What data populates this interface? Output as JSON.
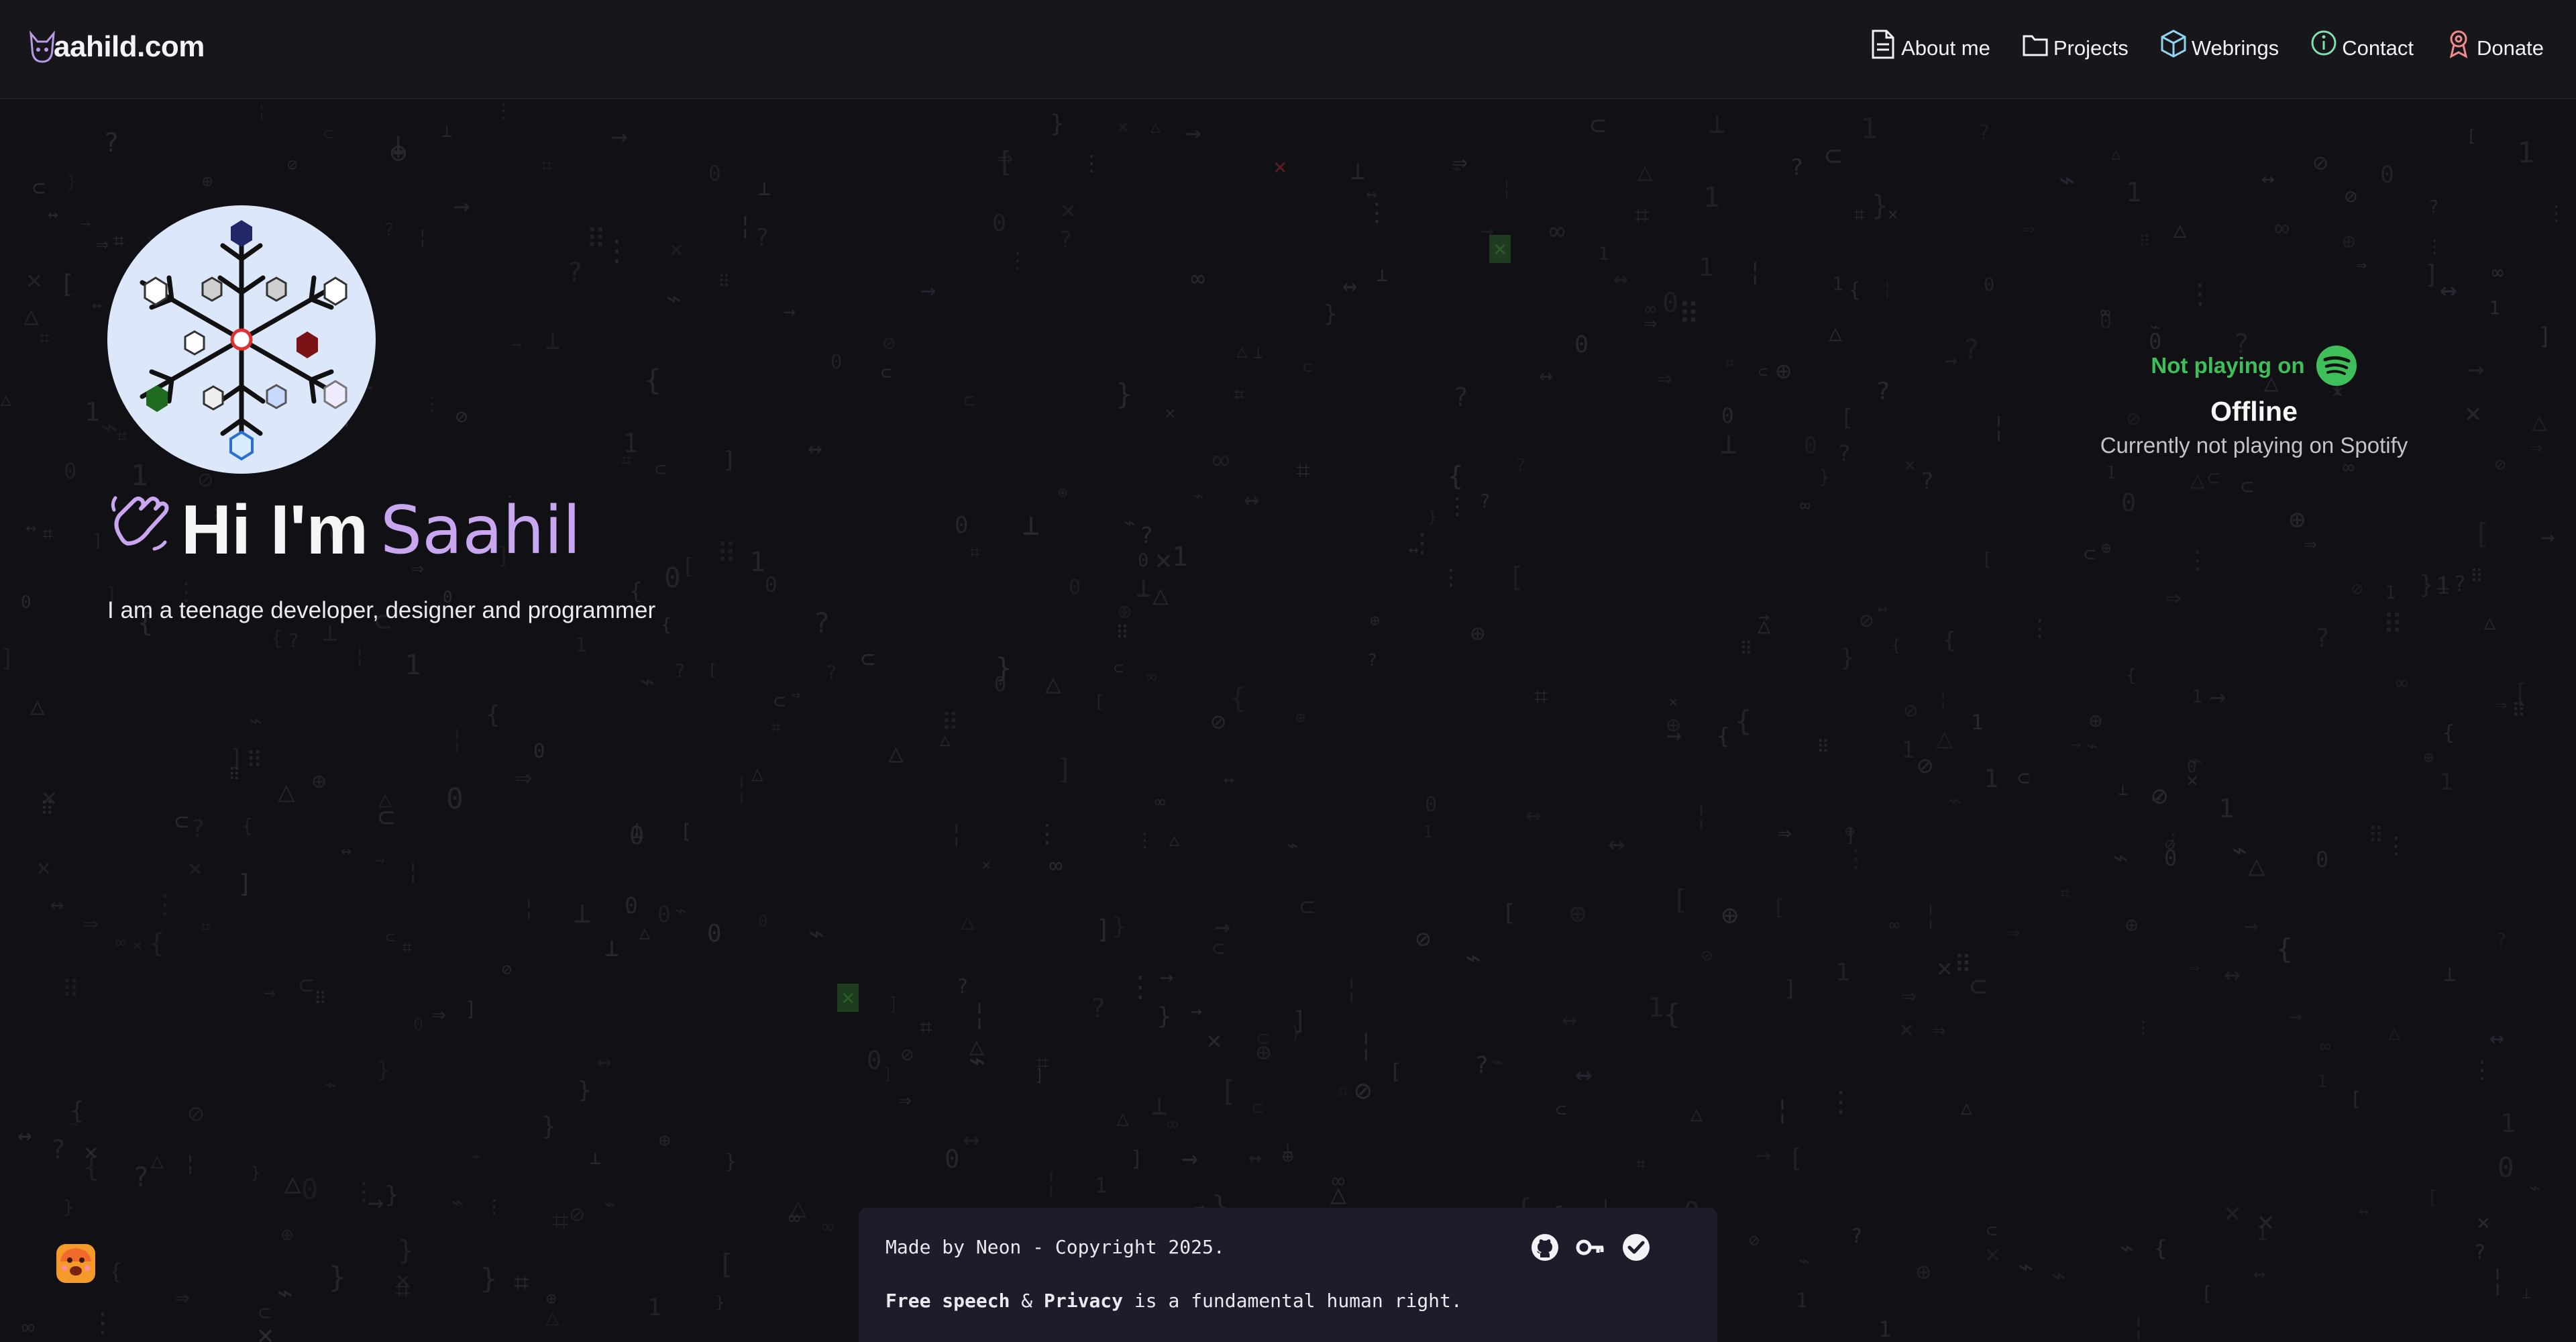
{
  "header": {
    "logo_text": "aahild.com",
    "nav": [
      {
        "label": "About me",
        "icon": "document-icon"
      },
      {
        "label": "Projects",
        "icon": "folder-icon"
      },
      {
        "label": "Webrings",
        "icon": "cube-icon"
      },
      {
        "label": "Contact",
        "icon": "info-icon"
      },
      {
        "label": "Donate",
        "icon": "award-icon"
      }
    ]
  },
  "hero": {
    "greeting": "Hi I'm",
    "name": "Saahil",
    "subtitle": "I am a teenage developer, designer and programmer"
  },
  "spotify": {
    "heading": "Not playing on",
    "status": "Offline",
    "detail": "Currently not playing on Spotify",
    "accent": "#3fbf5a"
  },
  "footer": {
    "made_by": "Made by Neon - Copyright 2025.",
    "free_speech": "Free speech",
    "ampersand": "&",
    "privacy": "Privacy",
    "rest": "is a fundamental human right.",
    "icons": [
      "github-icon",
      "key-icon",
      "verified-check-icon"
    ]
  },
  "colors": {
    "background": "#111115",
    "accent_purple": "#c9a6f0",
    "footer_bg": "#1d1c2a"
  }
}
